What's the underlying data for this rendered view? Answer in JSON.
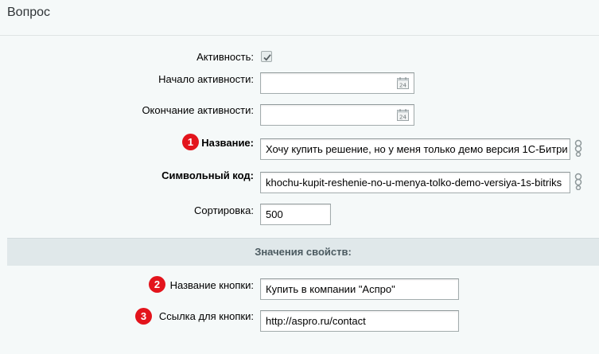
{
  "header": {
    "title": "Вопрос"
  },
  "form": {
    "active": {
      "label": "Активность:",
      "checked": true
    },
    "active_from": {
      "label": "Начало активности:",
      "value": ""
    },
    "active_to": {
      "label": "Окончание активности:",
      "value": ""
    },
    "name": {
      "label": "Название:",
      "value": "Хочу купить решение, но у меня только демо версия 1С-Битри",
      "badge": "1"
    },
    "code": {
      "label": "Символьный код:",
      "value": "khochu-kupit-reshenie-no-u-menya-tolko-demo-versiya-1s-bitriks"
    },
    "sort": {
      "label": "Сортировка:",
      "value": "500"
    }
  },
  "properties": {
    "section_title": "Значения свойств:",
    "button_name": {
      "label": "Название кнопки:",
      "value": "Купить в компании \"Аспро\"",
      "badge": "2"
    },
    "button_link": {
      "label": "Ссылка для кнопки:",
      "value": "http://aspro.ru/contact",
      "badge": "3"
    }
  },
  "icons": {
    "calendar": "calendar-icon",
    "transliterate": "transliterate-icon",
    "check": "checkmark-icon"
  },
  "colors": {
    "badge": "#e3141c",
    "section_bar": "#e0e8ea",
    "page_bg": "#f5f9f9"
  }
}
